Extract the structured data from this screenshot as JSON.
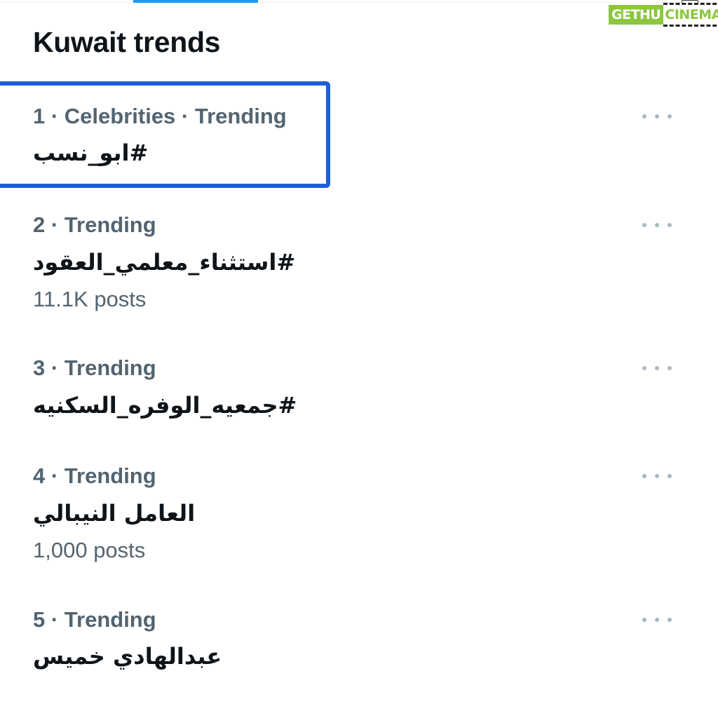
{
  "header": {
    "title": "Kuwait trends"
  },
  "watermark": {
    "left": "GETHU",
    "right": "CINEMA"
  },
  "trends": [
    {
      "meta": "1 · Celebrities · Trending",
      "name": "#ابو_نسب",
      "posts": ""
    },
    {
      "meta": "2 · Trending",
      "name": "#استثناء_معلمي_العقود",
      "posts": "11.1K posts"
    },
    {
      "meta": "3 · Trending",
      "name": "#جمعيه_الوفره_السكنيه",
      "posts": ""
    },
    {
      "meta": "4 · Trending",
      "name": "العامل النيبالي",
      "posts": "1,000 posts"
    },
    {
      "meta": "5 · Trending",
      "name": "عبدالهادي خميس",
      "posts": ""
    }
  ],
  "colors": {
    "accent": "#1d9bf0",
    "focus": "#1d5fd6",
    "secondary_text": "#536471",
    "primary_text": "#0f1419",
    "watermark_green": "#8cc63f"
  },
  "icons": {
    "more": "more-horizontal-icon",
    "camera": "camera-icon"
  }
}
